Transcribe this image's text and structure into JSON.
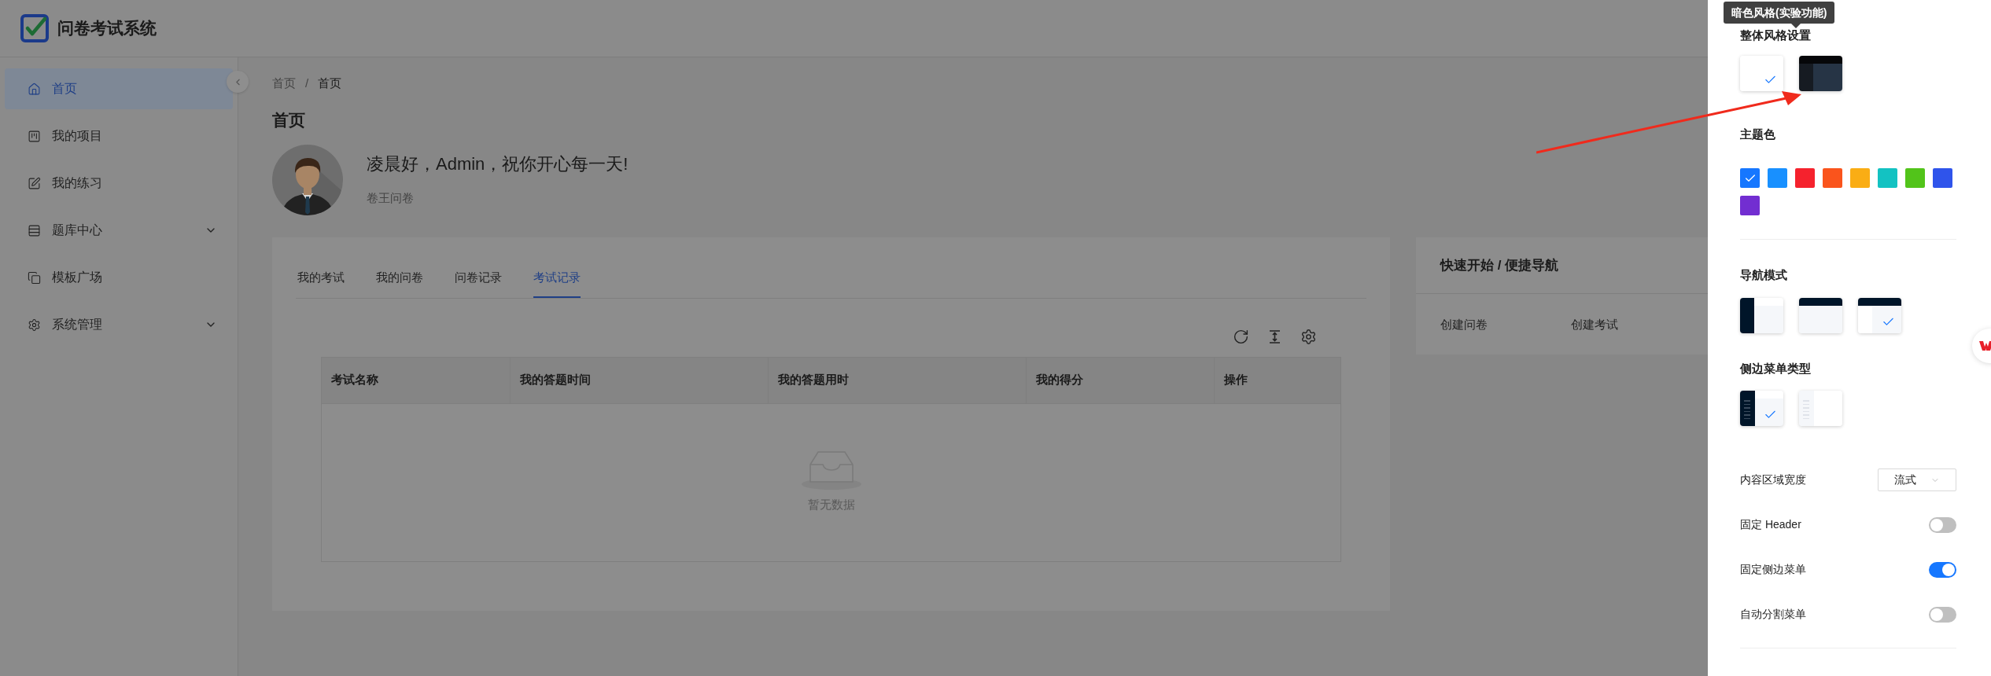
{
  "app": {
    "title": "问卷考试系统"
  },
  "sidebar": {
    "items": [
      {
        "label": "首页",
        "selected": true,
        "expandable": false
      },
      {
        "label": "我的项目",
        "selected": false,
        "expandable": false
      },
      {
        "label": "我的练习",
        "selected": false,
        "expandable": false
      },
      {
        "label": "题库中心",
        "selected": false,
        "expandable": true
      },
      {
        "label": "模板广场",
        "selected": false,
        "expandable": false
      },
      {
        "label": "系统管理",
        "selected": false,
        "expandable": true
      }
    ]
  },
  "breadcrumb": {
    "items": [
      "首页",
      "首页"
    ],
    "separator": "/"
  },
  "page_title": "首页",
  "welcome": {
    "greeting": "凌晨好，Admin，祝你开心每一天!",
    "subtitle": "卷王问卷"
  },
  "tabs": [
    {
      "label": "我的考试",
      "selected": false
    },
    {
      "label": "我的问卷",
      "selected": false
    },
    {
      "label": "问卷记录",
      "selected": false
    },
    {
      "label": "考试记录",
      "selected": true
    }
  ],
  "table": {
    "columns": [
      "考试名称",
      "我的答题时间",
      "我的答题用时",
      "我的得分",
      "操作"
    ],
    "empty_text": "暂无数据"
  },
  "quick_nav": {
    "title": "快速开始 / 便捷导航",
    "links": [
      "创建问卷",
      "创建考试"
    ]
  },
  "settings": {
    "style_heading": "整体风格设置",
    "tooltip": "暗色风格(实验功能)",
    "styles": [
      {
        "kind": "light",
        "selected": true
      },
      {
        "kind": "dark",
        "selected": false
      }
    ],
    "theme_heading": "主题色",
    "theme_colors": [
      {
        "color": "#1677ff",
        "selected": true
      },
      {
        "color": "#1890ff",
        "selected": false
      },
      {
        "color": "#f5222d",
        "selected": false
      },
      {
        "color": "#fa541c",
        "selected": false
      },
      {
        "color": "#faad14",
        "selected": false
      },
      {
        "color": "#13c2c2",
        "selected": false
      },
      {
        "color": "#52c41a",
        "selected": false
      },
      {
        "color": "#2f54eb",
        "selected": false
      },
      {
        "color": "#722ed1",
        "selected": false
      }
    ],
    "nav_heading": "导航模式",
    "nav_modes": [
      {
        "kind": "side",
        "selected": false
      },
      {
        "kind": "top",
        "selected": false
      },
      {
        "kind": "mix",
        "selected": true
      }
    ],
    "menu_type_heading": "侧边菜单类型",
    "menu_types": [
      {
        "kind": "dark",
        "selected": true
      },
      {
        "kind": "light",
        "selected": false
      }
    ],
    "options": [
      {
        "kind": "select",
        "label": "内容区域宽度",
        "value": "流式"
      },
      {
        "kind": "switch",
        "label": "固定 Header",
        "on": false
      },
      {
        "kind": "switch",
        "label": "固定侧边菜单",
        "on": true
      },
      {
        "kind": "switch",
        "label": "自动分割菜单",
        "on": false
      }
    ]
  }
}
